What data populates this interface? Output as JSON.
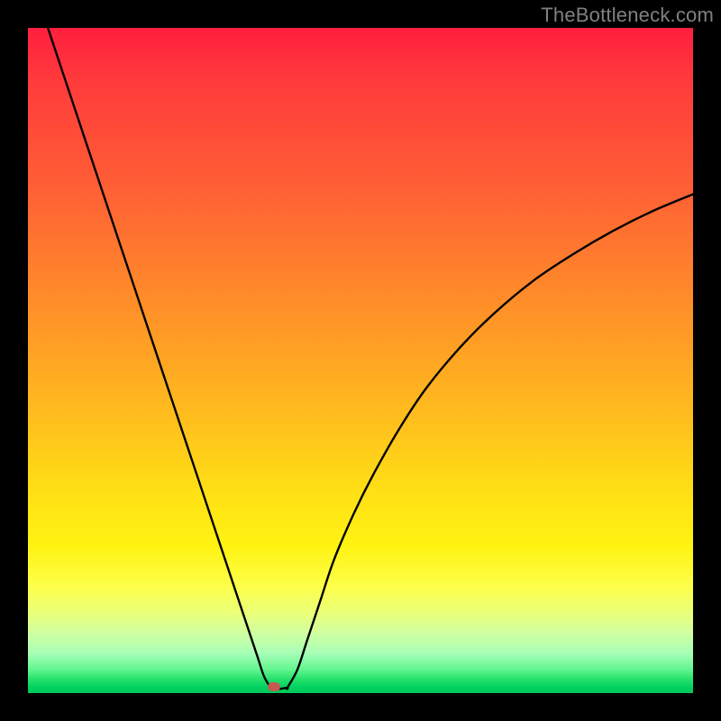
{
  "watermark": "TheBottleneck.com",
  "colors": {
    "frame": "#000000",
    "curve": "#000000",
    "marker": "#c35a52"
  },
  "chart_data": {
    "type": "line",
    "title": "",
    "xlabel": "",
    "ylabel": "",
    "xlim": [
      0,
      100
    ],
    "ylim": [
      0,
      100
    ],
    "grid": false,
    "legend": false,
    "annotations": [],
    "marker": {
      "x": 37,
      "y": 1
    },
    "series": [
      {
        "name": "left-branch",
        "x": [
          3,
          6,
          9,
          12,
          15,
          18,
          21,
          24,
          27,
          30,
          33,
          34.5,
          35.5,
          36.5
        ],
        "y": [
          100,
          91,
          82,
          73,
          64,
          55,
          46,
          37,
          28,
          19,
          10,
          5.5,
          2.5,
          0.8
        ]
      },
      {
        "name": "valley-floor",
        "x": [
          36.5,
          37.5,
          39.0
        ],
        "y": [
          0.8,
          0.6,
          0.8
        ]
      },
      {
        "name": "right-branch",
        "x": [
          39.0,
          40.5,
          42,
          44,
          46,
          49,
          52,
          56,
          60,
          65,
          70,
          76,
          82,
          88,
          94,
          100
        ],
        "y": [
          0.8,
          3.5,
          8,
          14,
          20,
          27,
          33,
          40,
          46,
          52,
          57,
          62,
          66,
          69.5,
          72.5,
          75
        ]
      }
    ]
  }
}
